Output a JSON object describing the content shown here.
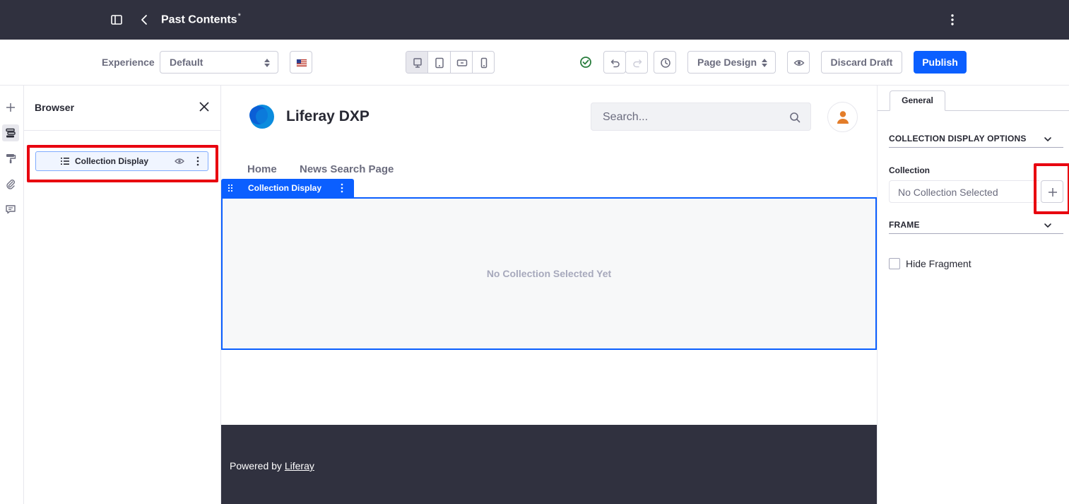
{
  "topbar": {
    "title": "Past Contents",
    "title_marker": "*",
    "icons": [
      "sidebar-toggle-icon",
      "back-chevron-icon",
      "kebab-menu-icon"
    ]
  },
  "toolbar": {
    "experience_label": "Experience",
    "experience_value": "Default",
    "locale_icon": "us-flag-icon",
    "device_icons": [
      "desktop-icon",
      "tablet-icon",
      "landscape-phone-icon",
      "portrait-phone-icon"
    ],
    "status_icon": "check-circle-icon",
    "page_design_label": "Page Design",
    "discard_label": "Discard Draft",
    "publish_label": "Publish"
  },
  "rail": {
    "icons": [
      "plus-icon",
      "browser-icon",
      "paint-roller-icon",
      "paperclip-icon",
      "comments-icon"
    ]
  },
  "browser": {
    "title": "Browser",
    "items": [
      {
        "label": "Collection Display"
      }
    ]
  },
  "canvas": {
    "site_name": "Liferay DXP",
    "search_placeholder": "Search...",
    "nav": [
      "Home",
      "News Search Page"
    ],
    "fragment_label": "Collection Display",
    "empty_message": "No Collection Selected Yet",
    "footer_prefix": "Powered by ",
    "footer_link": "Liferay"
  },
  "sidebar": {
    "tab": "General",
    "section_collection": "COLLECTION DISPLAY OPTIONS",
    "collection_label": "Collection",
    "collection_placeholder": "No Collection Selected",
    "section_frame": "FRAME",
    "hide_fragment_label": "Hide Fragment"
  },
  "colors": {
    "topbar_bg": "#30313f",
    "primary": "#0b5fff",
    "highlight": "#e8000f",
    "success": "#287d3c",
    "avatar_orange": "#e37d2a"
  }
}
